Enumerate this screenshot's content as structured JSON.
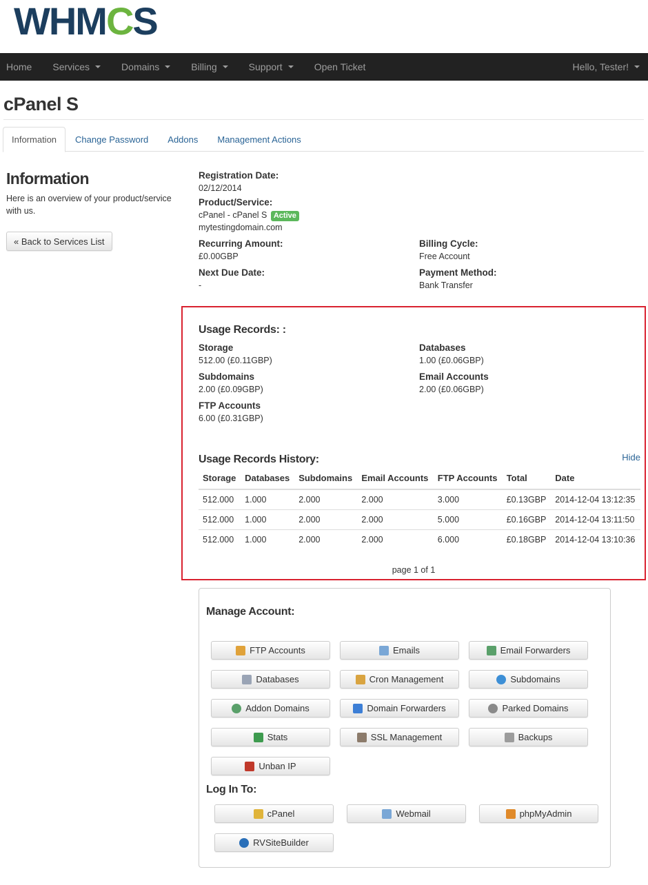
{
  "logo": {
    "text_a": "WHM",
    "text_gear": "C",
    "text_b": "S"
  },
  "nav": {
    "items": [
      {
        "label": "Home"
      },
      {
        "label": "Services"
      },
      {
        "label": "Domains"
      },
      {
        "label": "Billing"
      },
      {
        "label": "Support"
      },
      {
        "label": "Open Ticket"
      }
    ],
    "user": "Hello, Tester!"
  },
  "page_title": "cPanel S",
  "tabs": [
    "Information",
    "Change Password",
    "Addons",
    "Management Actions"
  ],
  "sidebar": {
    "heading": "Information",
    "description": "Here is an overview of your product/service with us.",
    "back_button": "« Back to Services List"
  },
  "details": {
    "registration_label": "Registration Date:",
    "registration_value": "02/12/2014",
    "product_label": "Product/Service:",
    "product_value": "cPanel - cPanel S",
    "status_badge": "Active",
    "domain": "mytestingdomain.com",
    "recurring_label": "Recurring Amount:",
    "recurring_value": "£0.00GBP",
    "billing_cycle_label": "Billing Cycle:",
    "billing_cycle_value": "Free Account",
    "next_due_label": "Next Due Date:",
    "next_due_value": "-",
    "payment_label": "Payment Method:",
    "payment_value": "Bank Transfer"
  },
  "usage": {
    "title": "Usage Records: :",
    "storage_label": "Storage",
    "storage_value": "512.00 (£0.11GBP)",
    "databases_label": "Databases",
    "databases_value": "1.00 (£0.06GBP)",
    "subdomains_label": "Subdomains",
    "subdomains_value": "2.00 (£0.09GBP)",
    "email_label": "Email Accounts",
    "email_value": "2.00 (£0.06GBP)",
    "ftp_label": "FTP Accounts",
    "ftp_value": "6.00 (£0.31GBP)"
  },
  "history": {
    "title": "Usage Records History:",
    "hide_link": "Hide",
    "columns": [
      "Storage",
      "Databases",
      "Subdomains",
      "Email Accounts",
      "FTP Accounts",
      "Total",
      "Date"
    ],
    "rows": [
      [
        "512.000",
        "1.000",
        "2.000",
        "2.000",
        "3.000",
        "£0.13GBP",
        "2014-12-04 13:12:35"
      ],
      [
        "512.000",
        "1.000",
        "2.000",
        "2.000",
        "5.000",
        "£0.16GBP",
        "2014-12-04 13:11:50"
      ],
      [
        "512.000",
        "1.000",
        "2.000",
        "2.000",
        "6.000",
        "£0.18GBP",
        "2014-12-04 13:10:36"
      ]
    ],
    "pager": "page 1 of 1"
  },
  "manage": {
    "title": "Manage Account:",
    "buttons": [
      {
        "label": "FTP Accounts",
        "icon": "ftp-user-icon",
        "color": "#e0a23a"
      },
      {
        "label": "Emails",
        "icon": "envelope-icon",
        "color": "#7aa7d6"
      },
      {
        "label": "Email Forwarders",
        "icon": "email-forward-icon",
        "color": "#5aa06a"
      },
      {
        "label": "Databases",
        "icon": "database-icon",
        "color": "#9aa4b5"
      },
      {
        "label": "Cron Management",
        "icon": "cron-icon",
        "color": "#d9a441"
      },
      {
        "label": "Subdomains",
        "icon": "globe-icon",
        "color": "#3d8fd6"
      },
      {
        "label": "Addon Domains",
        "icon": "globe-plus-icon",
        "color": "#5aa06a"
      },
      {
        "label": "Domain Forwarders",
        "icon": "arrows-icon",
        "color": "#3d7fd6"
      },
      {
        "label": "Parked Domains",
        "icon": "parked-icon",
        "color": "#8a8a8a"
      },
      {
        "label": "Stats",
        "icon": "stats-icon",
        "color": "#3e9b4f"
      },
      {
        "label": "SSL Management",
        "icon": "ssl-icon",
        "color": "#8c7b6b"
      },
      {
        "label": "Backups",
        "icon": "backup-icon",
        "color": "#9c9c9c"
      },
      {
        "label": "Unban IP",
        "icon": "unban-icon",
        "color": "#c0392b"
      }
    ],
    "login_title": "Log In To:",
    "login_buttons": [
      {
        "label": "cPanel",
        "icon": "cpanel-icon",
        "color": "#e0b43a"
      },
      {
        "label": "Webmail",
        "icon": "webmail-icon",
        "color": "#7aa7d6"
      },
      {
        "label": "phpMyAdmin",
        "icon": "phpmyadmin-icon",
        "color": "#e08a2a"
      },
      {
        "label": "RVSiteBuilder",
        "icon": "rvsitebuilder-icon",
        "color": "#2a6fb8"
      }
    ]
  }
}
